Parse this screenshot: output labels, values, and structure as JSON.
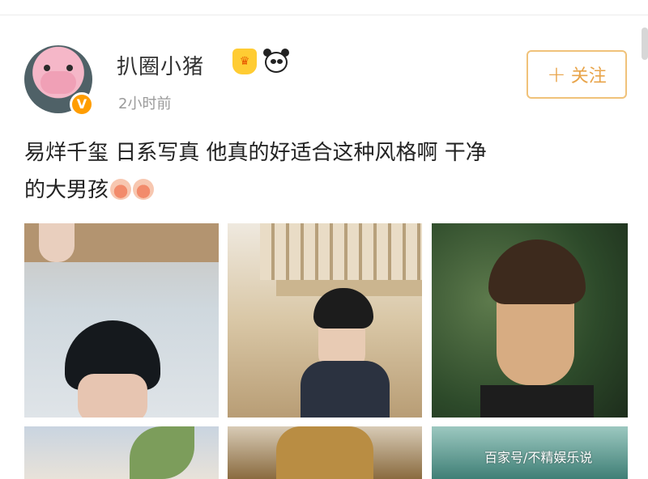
{
  "post": {
    "username": "扒圈小猪",
    "verified_mark": "V",
    "time": "2小时前",
    "follow_label": "关注",
    "follow_icon": "+",
    "text_line1": "易烊千玺 日系写真 他真的好适合这种风格啊 干净",
    "text_line2": "的大男孩",
    "emoji": [
      "blush-emoji",
      "blush-emoji"
    ],
    "badges": [
      "crown-badge-icon",
      "panda-icon"
    ],
    "images": [
      "photo-1",
      "photo-2",
      "photo-3",
      "photo-4",
      "photo-5",
      "photo-6"
    ]
  },
  "watermark": "百家号/不精娱乐说",
  "colors": {
    "follow_border": "#f0c27a",
    "follow_text": "#e8a44a",
    "verified": "#ff9d00",
    "time": "#9a9a9a"
  }
}
